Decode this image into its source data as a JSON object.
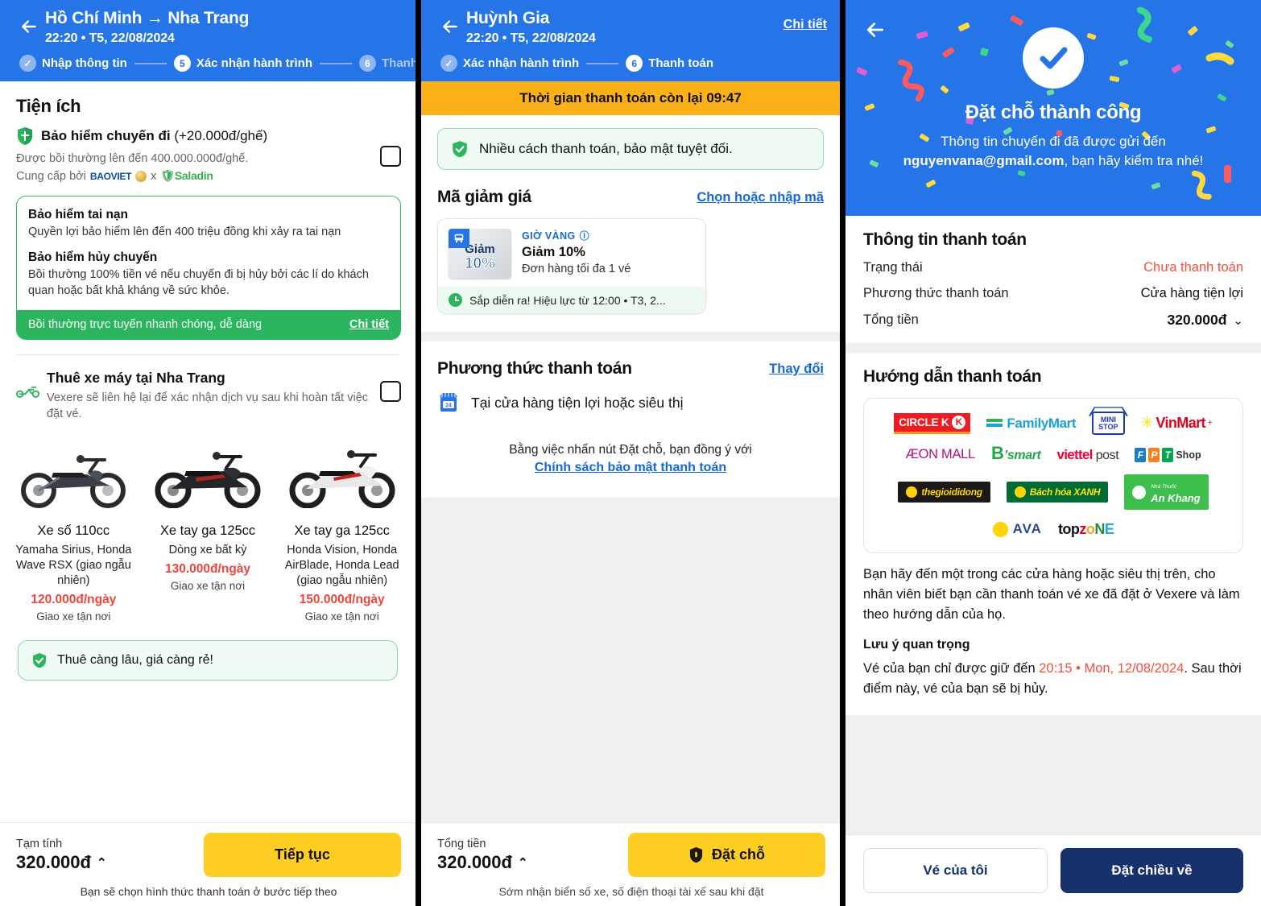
{
  "panel1": {
    "header": {
      "back_icon": "arrow-left-icon",
      "title": "Hồ Chí Minh → Nha Trang",
      "subtitle": "22:20 • T5, 22/08/2024",
      "steps": [
        {
          "num": "✓",
          "label": "Nhập thông tin",
          "state": "done"
        },
        {
          "num": "5",
          "label": "Xác nhận hành trình",
          "state": "current"
        },
        {
          "num": "6",
          "label": "Thanh",
          "state": "next"
        }
      ]
    },
    "section_title": "Tiện ích",
    "insurance": {
      "icon": "shield-icon",
      "title": "Bảo hiểm chuyến đi",
      "title_suffix": "(+20.000đ/ghế)",
      "line1": "Được bồi thường lên đến 400.000.000đ/ghế.",
      "provider_prefix": "Cung cấp bởi",
      "provider_1": "BAOVIET",
      "provider_sep": "x",
      "provider_2": "Saladin",
      "checkbox": "insurance-checkbox"
    },
    "insurance_card": {
      "b1_title": "Bảo hiểm tai nạn",
      "b1_text": "Quyền lợi bảo hiểm lên đến 400 triệu đồng khi xảy ra tai nạn",
      "b2_title": "Bảo hiểm hủy chuyến",
      "b2_text": "Bồi thường 100% tiền vé nếu chuyến đi bị hủy bởi các lí do khách quan hoặc bất khả kháng về sức khỏe.",
      "footer_text": "Bồi thường trực tuyến nhanh chóng, dễ dàng",
      "footer_link": "Chi tiết"
    },
    "moto": {
      "icon": "motorbike-icon",
      "title": "Thuê xe máy tại Nha Trang",
      "subtitle": "Vexere sẽ liên hệ lại để xác nhận dịch vụ sau khi hoàn tất việc đặt vé.",
      "checkbox": "motorbike-checkbox",
      "bikes": [
        {
          "name": "Xe số 110cc",
          "desc": "Yamaha Sirius, Honda Wave RSX (giao ngẫu nhiên)",
          "price": "120.000đ/ngày",
          "ship": "Giao xe tận nơi"
        },
        {
          "name": "Xe tay ga 125cc",
          "desc": "Dòng xe bất kỳ",
          "price": "130.000đ/ngày",
          "ship": "Giao xe tận nơi"
        },
        {
          "name": "Xe tay ga 125cc",
          "desc": "Honda Vision, Honda AirBlade, Honda Lead (giao ngẫu nhiên)",
          "price": "150.000đ/ngày",
          "ship": "Giao xe tận nơi"
        }
      ]
    },
    "promo_note": "Thuê càng lâu, giá càng rẻ!",
    "footer": {
      "label": "Tạm tính",
      "amount": "320.000đ",
      "chevron": "chevron-up-icon",
      "button": "Tiếp tục",
      "note": "Bạn sẽ chọn hình thức thanh toán ở bước tiếp theo"
    }
  },
  "panel2": {
    "header": {
      "back_icon": "arrow-left-icon",
      "title": "Huỳnh Gia",
      "subtitle": "22:20 • T5, 22/08/2024",
      "detail_link": "Chi tiết",
      "steps": [
        {
          "num": "✓",
          "label": "Xác nhận hành trình",
          "state": "done"
        },
        {
          "num": "6",
          "label": "Thanh toán",
          "state": "current"
        }
      ]
    },
    "timer": "Thời gian thanh toán còn lại 09:47",
    "secure_banner": "Nhiều cách thanh toán, bảo mật tuyệt đối.",
    "voucher_section": {
      "title": "Mã giảm giá",
      "link": "Chọn hoặc nhập mã",
      "card": {
        "badge_icon": "bus-icon",
        "img_line1": "Giảm",
        "img_line2": "10%",
        "tag": "GIỜ VÀNG",
        "tag_icon": "info-icon",
        "title": "Giảm 10%",
        "subtitle": "Đơn hàng tối đa 1 vé",
        "footer_icon": "clock-icon",
        "footer": "Sắp diễn ra! Hiệu lực từ 12:00 • T3, 2..."
      }
    },
    "payment_section": {
      "title": "Phương thức thanh toán",
      "link": "Thay đổi",
      "method_icon": "store-24h-icon",
      "method": "Tại cửa hàng tiện lợi hoặc siêu thị",
      "agree_text": "Bằng việc nhấn nút Đặt chỗ, bạn đồng ý với",
      "agree_link": "Chính sách bảo mật thanh toán"
    },
    "footer": {
      "label": "Tổng tiền",
      "amount": "320.000đ",
      "chevron": "chevron-up-icon",
      "button_icon": "shield-icon",
      "button": "Đặt chỗ",
      "note": "Sớm nhận biển số xe, số điện thoại tài xế sau khi đặt"
    }
  },
  "panel3": {
    "back_icon": "arrow-left-icon",
    "check_icon": "check-circle-icon",
    "title": "Đặt chỗ thành công",
    "sub_line1": "Thông tin chuyến đi đã được gửi đến",
    "email": "nguyenvana@gmail.com",
    "sub_line2": ", bạn hãy kiểm tra nhé!",
    "payment_info": {
      "title": "Thông tin thanh toán",
      "rows": [
        {
          "key": "Trạng thái",
          "value": "Chưa thanh toán",
          "style": "red"
        },
        {
          "key": "Phương thức thanh toán",
          "value": "Cửa hàng tiện lợi",
          "style": "normal"
        },
        {
          "key": "Tổng tiền",
          "value": "320.000đ",
          "style": "bold",
          "chevron": "chevron-down-icon"
        }
      ]
    },
    "guide": {
      "title": "Hướng dẫn thanh toán",
      "logos": [
        [
          "CIRCLE K",
          "FamilyMart",
          "MINI STOP",
          "VinMart"
        ],
        [
          "ÆON MALL",
          "B'smart",
          "viettel post",
          "FPT Shop"
        ],
        [
          "thegioididong",
          "Bách hóa XANH",
          "An Khang"
        ],
        [
          "AVA",
          "topzone"
        ]
      ],
      "body": "Bạn hãy đến một trong các cửa hàng hoặc siêu thị trên, cho nhân viên biết bạn cần thanh toán vé xe đã đặt ở Vexere và làm theo hướng dẫn của họ.",
      "note_title": "Lưu ý quan trọng",
      "note_pre": "Vé của bạn chỉ được giữ đến ",
      "note_time": "20:15 • Mon, 12/08/2024",
      "note_post": ". Sau thời điểm này, vé của bạn sẽ bị hủy."
    },
    "footer": {
      "btn_left": "Vé của tôi",
      "btn_right": "Đặt chiều về"
    }
  },
  "colors": {
    "brand_blue": "#2574E8",
    "yellow": "#FFCE22",
    "orange": "#FBB117",
    "green": "#2AB55E",
    "red": "#F4503C",
    "navy": "#16316B"
  }
}
